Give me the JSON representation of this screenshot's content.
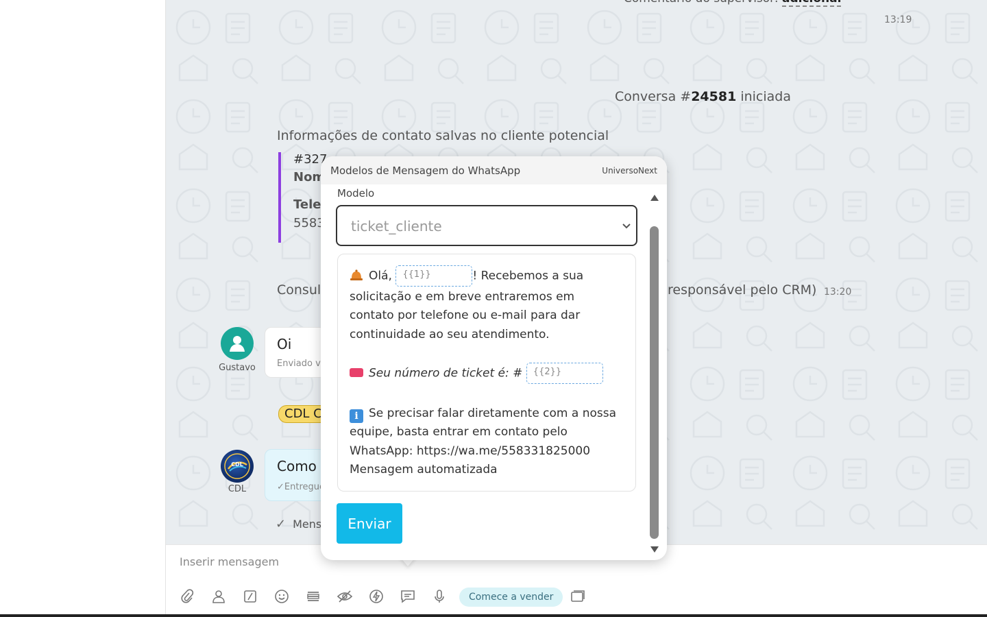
{
  "chat": {
    "supervisor_comment_label": "Comentário do supervisor: ",
    "supervisor_comment_value": "adicional",
    "time_1": "13:19",
    "conversation_prefix": "Conversa #",
    "conversation_number": "24581",
    "conversation_suffix": " iniciada",
    "contact_info_title": "Informações de contato salvas no cliente potencial",
    "contact_card_line1": "#327",
    "contact_card_line2": "Nom",
    "contact_card_line3": "Telef",
    "contact_card_line4": "5583",
    "consult_text": "Consul",
    "responsible_text": "responsável pelo CRM)",
    "time_2": "13:20",
    "gustavo_name": "Gustavo",
    "gustavo_message": "Oi",
    "gustavo_message_status": "Enviado vi",
    "cdl_tag": "CDL C",
    "cdl_name": "CDL",
    "cdl_message": "Como",
    "cdl_message_status": "✓Entregue",
    "mens_text": "Mens"
  },
  "composer": {
    "placeholder": "Inserir mensagem",
    "sell_button": "Comece a vender"
  },
  "popup": {
    "title": "Modelos de Mensagem do WhatsApp",
    "brand": "UniversoNext",
    "model_label": "Modelo",
    "selected_model": "ticket_cliente",
    "greeting": "Olá,",
    "placeholder_1": "{{1}}",
    "line1_tail": "! Recebemos a sua",
    "line2": "solicitação e em breve entraremos em",
    "line3": "contato por telefone ou e-mail para dar",
    "line4": "continuidade ao seu atendimento.",
    "ticket_text": "Seu número de ticket é: #",
    "placeholder_2": "{{2}}",
    "line6": "Se precisar falar diretamente com a nossa",
    "line7": "equipe, basta entrar em contato pelo",
    "line8": "WhatsApp: https://wa.me/558331825000",
    "line9": "Mensagem automatizada",
    "send_button": "Enviar"
  },
  "colors": {
    "accent": "#12b9e8",
    "gustavo_avatar": "#1aa898",
    "contact_card_border": "#8d3fe0",
    "cdl_tag": "#f7d96a"
  }
}
